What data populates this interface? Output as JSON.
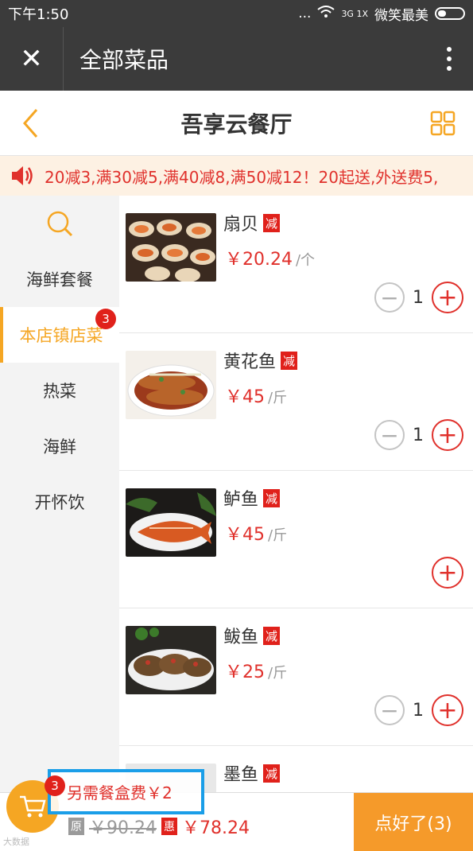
{
  "status": {
    "time": "下午1:50",
    "dots": "...",
    "network": "3G 1X",
    "carrier": "微笑最美"
  },
  "topbar": {
    "title": "全部菜品",
    "close_icon": "close-icon",
    "more_icon": "more-vertical-icon"
  },
  "header": {
    "shop_name": "吾享云餐厅",
    "back_icon": "back-chevron-icon",
    "grid_icon": "grid-icon"
  },
  "notice": {
    "icon": "speaker-icon",
    "text": "20减3,满30减5,满40减8,满50减12！20起送,外送费5,"
  },
  "sidebar": {
    "search_icon": "search-icon",
    "categories": [
      {
        "label": "海鲜套餐"
      },
      {
        "label": "本店镇店菜",
        "badge": "3",
        "active": true
      },
      {
        "label": "热菜"
      },
      {
        "label": "海鲜"
      },
      {
        "label": "开怀饮"
      }
    ]
  },
  "dishes": [
    {
      "name": "扇贝",
      "tag": "减",
      "price": "￥20.24",
      "unit": "/个",
      "qty": "1"
    },
    {
      "name": "黄花鱼",
      "tag": "减",
      "price": "￥45",
      "unit": "/斤",
      "qty": "1"
    },
    {
      "name": "鲈鱼",
      "tag": "减",
      "price": "￥45",
      "unit": "/斤",
      "qty": ""
    },
    {
      "name": "鲅鱼",
      "tag": "减",
      "price": "￥25",
      "unit": "/斤",
      "qty": "1"
    },
    {
      "name": "墨鱼",
      "tag": "减",
      "price": "",
      "unit": "",
      "qty": ""
    }
  ],
  "cart": {
    "badge": "3",
    "extra_fee": "另需餐盒费￥2",
    "orig_label": "原",
    "orig_price": "￥90.24",
    "discount_label": "惠",
    "final_price": "￥78.24",
    "checkout": "点好了(3)"
  },
  "watermark": "大数据"
}
